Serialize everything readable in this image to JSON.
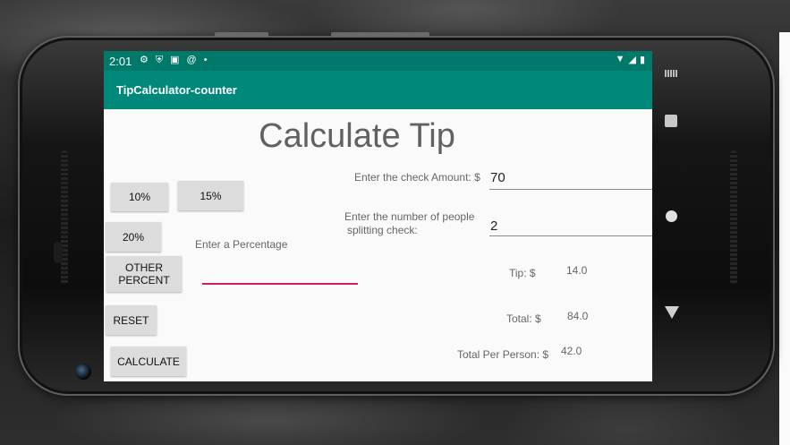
{
  "status_bar": {
    "time": "2:01",
    "icons": [
      "gear-icon",
      "shield-icon",
      "app-icon",
      "at-icon",
      "dot-icon"
    ],
    "right_icons": [
      "wifi-icon",
      "signal-icon",
      "battery-icon"
    ]
  },
  "app_bar": {
    "title": "TipCalculator-counter"
  },
  "heading": "Calculate Tip",
  "buttons": {
    "ten": "10%",
    "fifteen": "15%",
    "twenty": "20%",
    "other_line1": "OTHER",
    "other_line2": "PERCENT",
    "reset": "RESET",
    "calculate": "CALCULATE"
  },
  "percentage_label": "Enter a Percentage",
  "check_amount": {
    "label": "Enter the check Amount: $",
    "value": "70"
  },
  "people": {
    "label_line1": "Enter the number of people",
    "label_line2": "splitting check:",
    "value": "2"
  },
  "results": {
    "tip_label": "Tip: $",
    "tip_value": "14.0",
    "total_label": "Total: $",
    "total_value": "84.0",
    "per_person_label": "Total Per Person: $",
    "per_person_value": "42.0"
  },
  "colors": {
    "status_bar": "#00796b",
    "app_bar": "#00897b",
    "accent": "#d81b60"
  }
}
